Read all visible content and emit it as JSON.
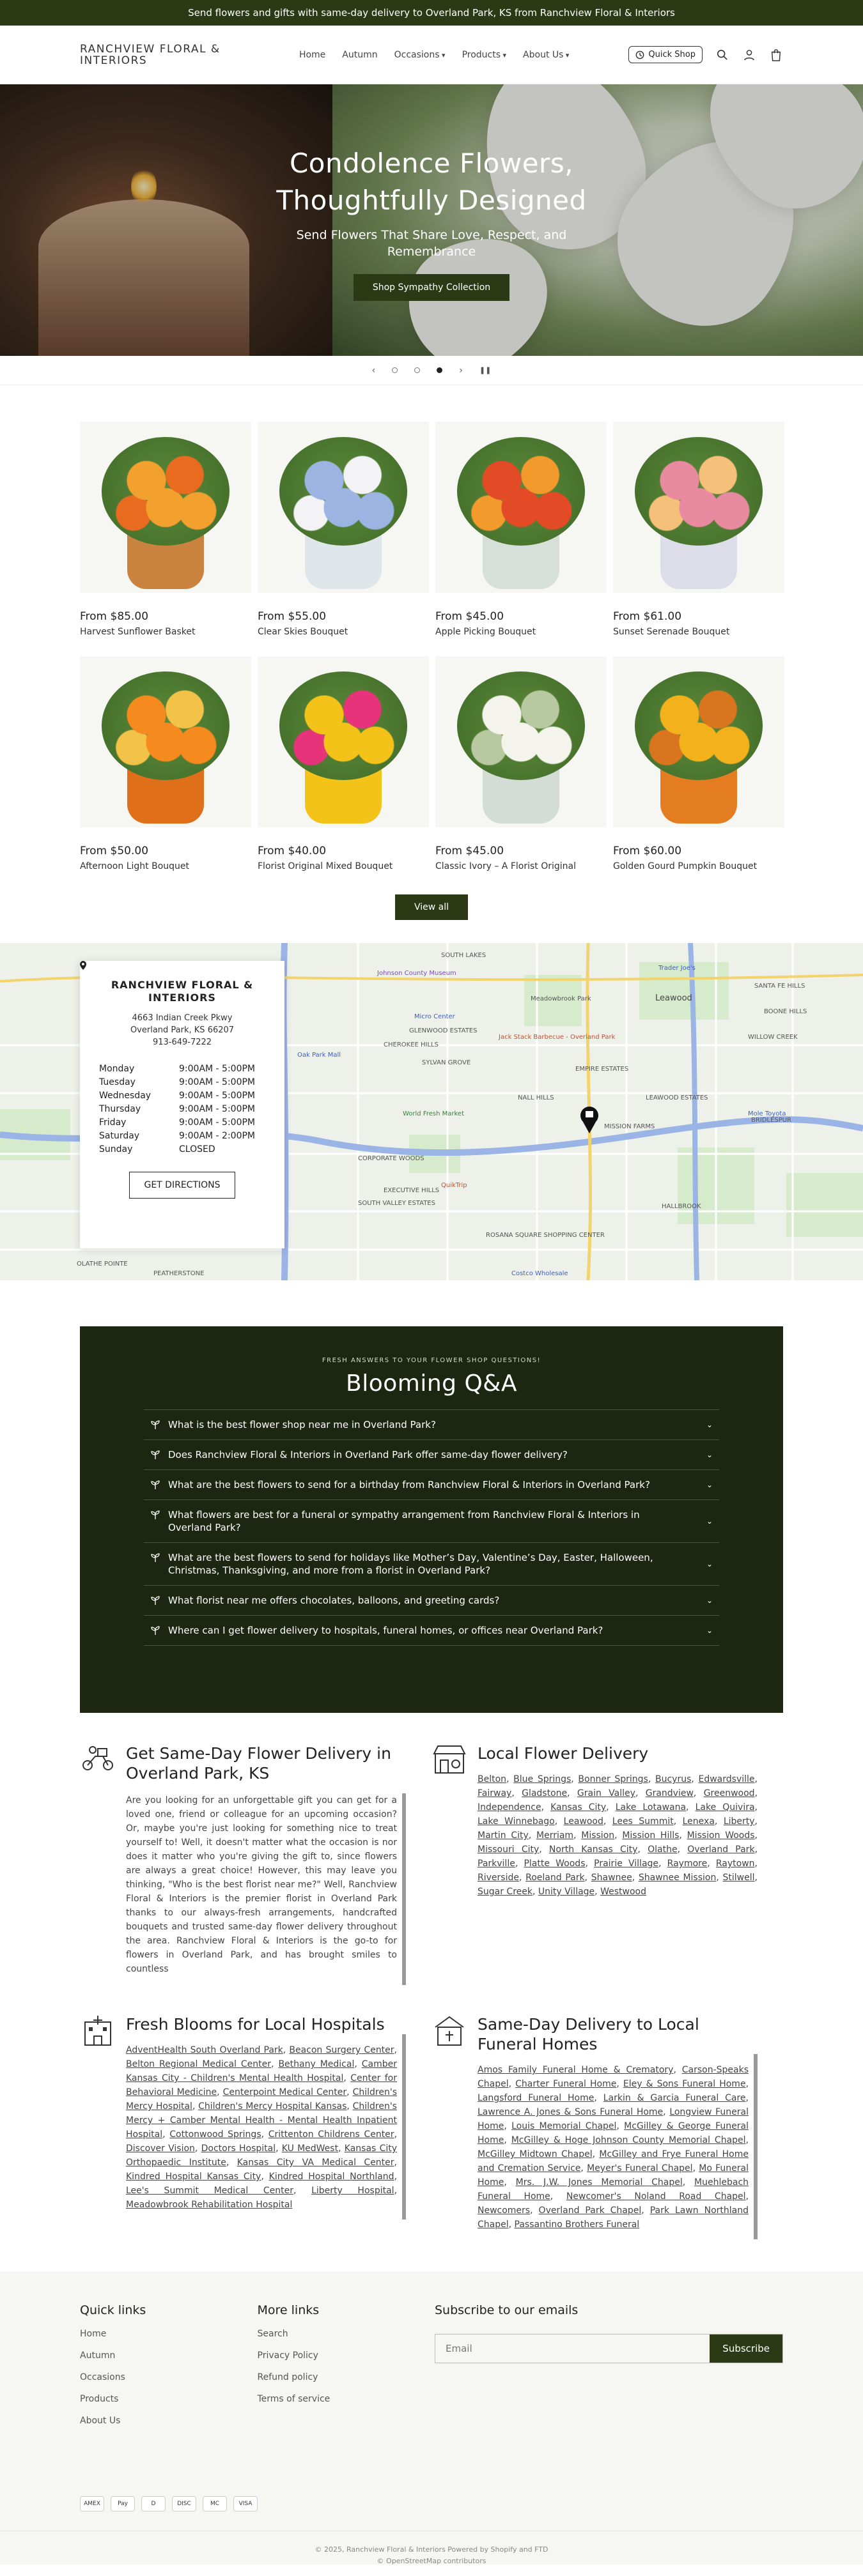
{
  "announcement": "Send flowers and gifts with same-day delivery to Overland Park, KS from Ranchview Floral & Interiors",
  "header": {
    "logo_line1": "RANCHVIEW FLORAL &",
    "logo_line2": "INTERIORS",
    "nav": [
      "Home",
      "Autumn",
      "Occasions",
      "Products",
      "About Us"
    ],
    "quick_shop": "Quick Shop"
  },
  "hero": {
    "title_line1": "Condolence Flowers,",
    "title_line2": "Thoughtfully Designed",
    "subtitle_line1": "Send Flowers That Share Love, Respect, and",
    "subtitle_line2": "Remembrance",
    "cta": "Shop Sympathy Collection"
  },
  "products": [
    {
      "price": "From $85.00",
      "name": "Harvest Sunflower Basket",
      "c1": "#f2a12e",
      "c2": "#e96b1f",
      "vase": "#c9833f"
    },
    {
      "price": "From $55.00",
      "name": "Clear Skies Bouquet",
      "c1": "#9db4e2",
      "c2": "#f3f3f6",
      "vase": "#dfe6ea"
    },
    {
      "price": "From $45.00",
      "name": "Apple Picking Bouquet",
      "c1": "#e34b26",
      "c2": "#f39a2c",
      "vase": "#d6dfd8"
    },
    {
      "price": "From $61.00",
      "name": "Sunset Serenade Bouquet",
      "c1": "#e88aa0",
      "c2": "#f4c07a",
      "vase": "#dcdde8"
    },
    {
      "price": "From $50.00",
      "name": "Afternoon Light Bouquet",
      "c1": "#f58a1f",
      "c2": "#f3c248",
      "vase": "#e06f1a"
    },
    {
      "price": "From $40.00",
      "name": "Florist Original Mixed Bouquet",
      "c1": "#f3c31a",
      "c2": "#e6337a",
      "vase": "#f3c31a"
    },
    {
      "price": "From $45.00",
      "name": "Classic Ivory – A Florist Original",
      "c1": "#f4f3ec",
      "c2": "#b8c9a2",
      "vase": "#d4dcd6"
    },
    {
      "price": "From $60.00",
      "name": "Golden Gourd Pumpkin Bouquet",
      "c1": "#f3b21c",
      "c2": "#d9751f",
      "vase": "#e47d22"
    }
  ],
  "view_all": "View all",
  "map": {
    "store_name_line1": "RANCHVIEW FLORAL &",
    "store_name_line2": "INTERIORS",
    "address_line1": "4663 Indian Creek Pkwy",
    "address_line2": "Overland Park, KS 66207",
    "phone": "913-649-7222",
    "hours": [
      {
        "day": "Monday",
        "time": "9:00AM - 5:00PM"
      },
      {
        "day": "Tuesday",
        "time": "9:00AM - 5:00PM"
      },
      {
        "day": "Wednesday",
        "time": "9:00AM - 5:00PM"
      },
      {
        "day": "Thursday",
        "time": "9:00AM - 5:00PM"
      },
      {
        "day": "Friday",
        "time": "9:00AM - 5:00PM"
      },
      {
        "day": "Saturday",
        "time": "9:00AM - 2:00PM"
      },
      {
        "day": "Sunday",
        "time": "CLOSED"
      }
    ],
    "directions": "GET DIRECTIONS",
    "labels": [
      "SOUTH LAKES",
      "Leawood",
      "GLENWOOD ESTATES",
      "CHEROKEE HILLS",
      "SYLVAN GROVE",
      "NALL HILLS",
      "EMPIRE ESTATES",
      "LEAWOOD ESTATES",
      "MISSION FARMS",
      "BRIDLESPUR",
      "CORPORATE WOODS",
      "ROSANA SQUARE SHOPPING CENTER",
      "SOUTH VALLEY ESTATES",
      "HALLBROOK",
      "SANTA FE HILLS",
      "BOONE HILLS",
      "WILLOW CREEK",
      "OLATHE POINTE",
      "PEATHERSTONE",
      "Jack Stack Barbecue - Overland Park",
      "World Fresh Market",
      "Micro Center",
      "Trader Joe's",
      "Costco Wholesale",
      "Johnson County Museum",
      "Oak Park Mall",
      "Meadowbrook Park",
      "QuikTrip",
      "Mole Toyota",
      "EXECUTIVE HILLS"
    ]
  },
  "faq": {
    "eyebrow": "FRESH ANSWERS TO YOUR FLOWER SHOP QUESTIONS!",
    "title": "Blooming Q&A",
    "items": [
      "What is the best flower shop near me in Overland Park?",
      "Does Ranchview Floral & Interiors in Overland Park offer same-day flower delivery?",
      "What are the best flowers to send for a birthday from Ranchview Floral & Interiors in Overland Park?",
      "What flowers are best for a funeral or sympathy arrangement from Ranchview Floral & Interiors in Overland Park?",
      "What are the best flowers to send for holidays like Mother’s Day, Valentine’s Day, Easter, Halloween, Christmas, Thanksgiving, and more from a florist in Overland Park?",
      "What florist near me offers chocolates, balloons, and greeting cards?",
      "Where can I get flower delivery to hospitals, funeral homes, or offices near Overland Park?"
    ]
  },
  "local": {
    "sameday": {
      "title": "Get Same-Day Flower Delivery in Overland Park, KS",
      "body": "Are you looking for an unforgettable gift you can get for a loved one, friend or colleague for an upcoming occasion? Or, maybe you're just looking for something nice to treat yourself to! Well, it doesn't matter what the occasion is nor does it matter who you're giving the gift to, since flowers are always a great choice! However, this may leave you thinking, \"Who is the best florist near me?\" Well, Ranchview Floral & Interiors is the premier florist in Overland Park thanks to our always-fresh arrangements, handcrafted bouquets and trusted same-day flower delivery throughout the area. Ranchview Floral & Interiors is the go-to for flowers in Overland Park, and has brought smiles to countless"
    },
    "delivery": {
      "title": "Local Flower Delivery",
      "links": [
        "Belton",
        "Blue Springs",
        "Bonner Springs",
        "Bucyrus",
        "Edwardsville",
        "Fairway",
        "Gladstone",
        "Grain Valley",
        "Grandview",
        "Greenwood",
        "Independence",
        "Kansas City",
        "Lake Lotawana",
        "Lake Quivira",
        "Lake Winnebago",
        "Leawood",
        "Lees Summit",
        "Lenexa",
        "Liberty",
        "Martin City",
        "Merriam",
        "Mission",
        "Mission Hills",
        "Mission Woods",
        "Missouri City",
        "North Kansas City",
        "Olathe",
        "Overland Park",
        "Parkville",
        "Platte Woods",
        "Prairie Village",
        "Raymore",
        "Raytown",
        "Riverside",
        "Roeland Park",
        "Shawnee",
        "Shawnee Mission",
        "Stilwell",
        "Sugar Creek",
        "Unity Village",
        "Westwood"
      ]
    },
    "hospitals": {
      "title": "Fresh Blooms for Local Hospitals",
      "links": [
        "AdventHealth South Overland Park",
        "Beacon Surgery Center",
        "Belton Regional Medical Center",
        "Bethany Medical",
        "Camber Kansas City - Children's Mental Health Hospital",
        "Center for Behavioral Medicine",
        "Centerpoint Medical Center",
        "Children's Mercy Hospital",
        "Children's Mercy Hospital Kansas",
        "Children's Mercy + Camber Mental Health - Mental Health Inpatient Hospital",
        "Cottonwood Springs",
        "Crittenton Childrens Center",
        "Discover Vision",
        "Doctors Hospital",
        "KU MedWest",
        "Kansas City Orthopaedic Institute",
        "Kansas City VA Medical Center",
        "Kindred Hospital Kansas City",
        "Kindred Hospital Northland",
        "Lee's Summit Medical Center",
        "Liberty Hospital",
        "Meadowbrook Rehabilitation Hospital"
      ]
    },
    "funeral": {
      "title": "Same-Day Delivery to Local Funeral Homes",
      "links": [
        "Amos Family Funeral Home & Crematory",
        "Carson-Speaks Chapel",
        "Charter Funeral Home",
        "Eley & Sons Funeral Home",
        "Langsford Funeral Home",
        "Larkin & Garcia Funeral Care",
        "Lawrence A. Jones & Sons Funeral Home",
        "Longview Funeral Home",
        "Louis Memorial Chapel",
        "McGilley & George Funeral Home",
        "McGilley & Hoge Johnson County Memorial Chapel",
        "McGilley Midtown Chapel",
        "McGilley and Frye Funeral Home and Cremation Service",
        "Meyer's Funeral Chapel",
        "Mo Funeral Home",
        "Mrs. J.W. Jones Memorial Chapel",
        "Muehlebach Funeral Home",
        "Newcomer's Noland Road Chapel",
        "Newcomers",
        "Overland Park Chapel",
        "Park Lawn Northland Chapel",
        "Passantino Brothers Funeral"
      ]
    }
  },
  "footer": {
    "quick_title": "Quick links",
    "quick": [
      "Home",
      "Autumn",
      "Occasions",
      "Products",
      "About Us"
    ],
    "more_title": "More links",
    "more": [
      "Search",
      "Privacy Policy",
      "Refund policy",
      "Terms of service"
    ],
    "subscribe_title": "Subscribe to our emails",
    "email_placeholder": "Email",
    "subscribe_btn": "Subscribe",
    "payments": [
      "AMEX",
      "Pay",
      "D",
      "DISC",
      "MC",
      "VISA"
    ],
    "copy1": "© 2025, Ranchview Floral & Interiors Powered by Shopify and FTD",
    "copy2": "© OpenStreetMap contributors"
  },
  "colors": {
    "brand": "#2b3a14",
    "faq_bg": "#1d2611"
  }
}
